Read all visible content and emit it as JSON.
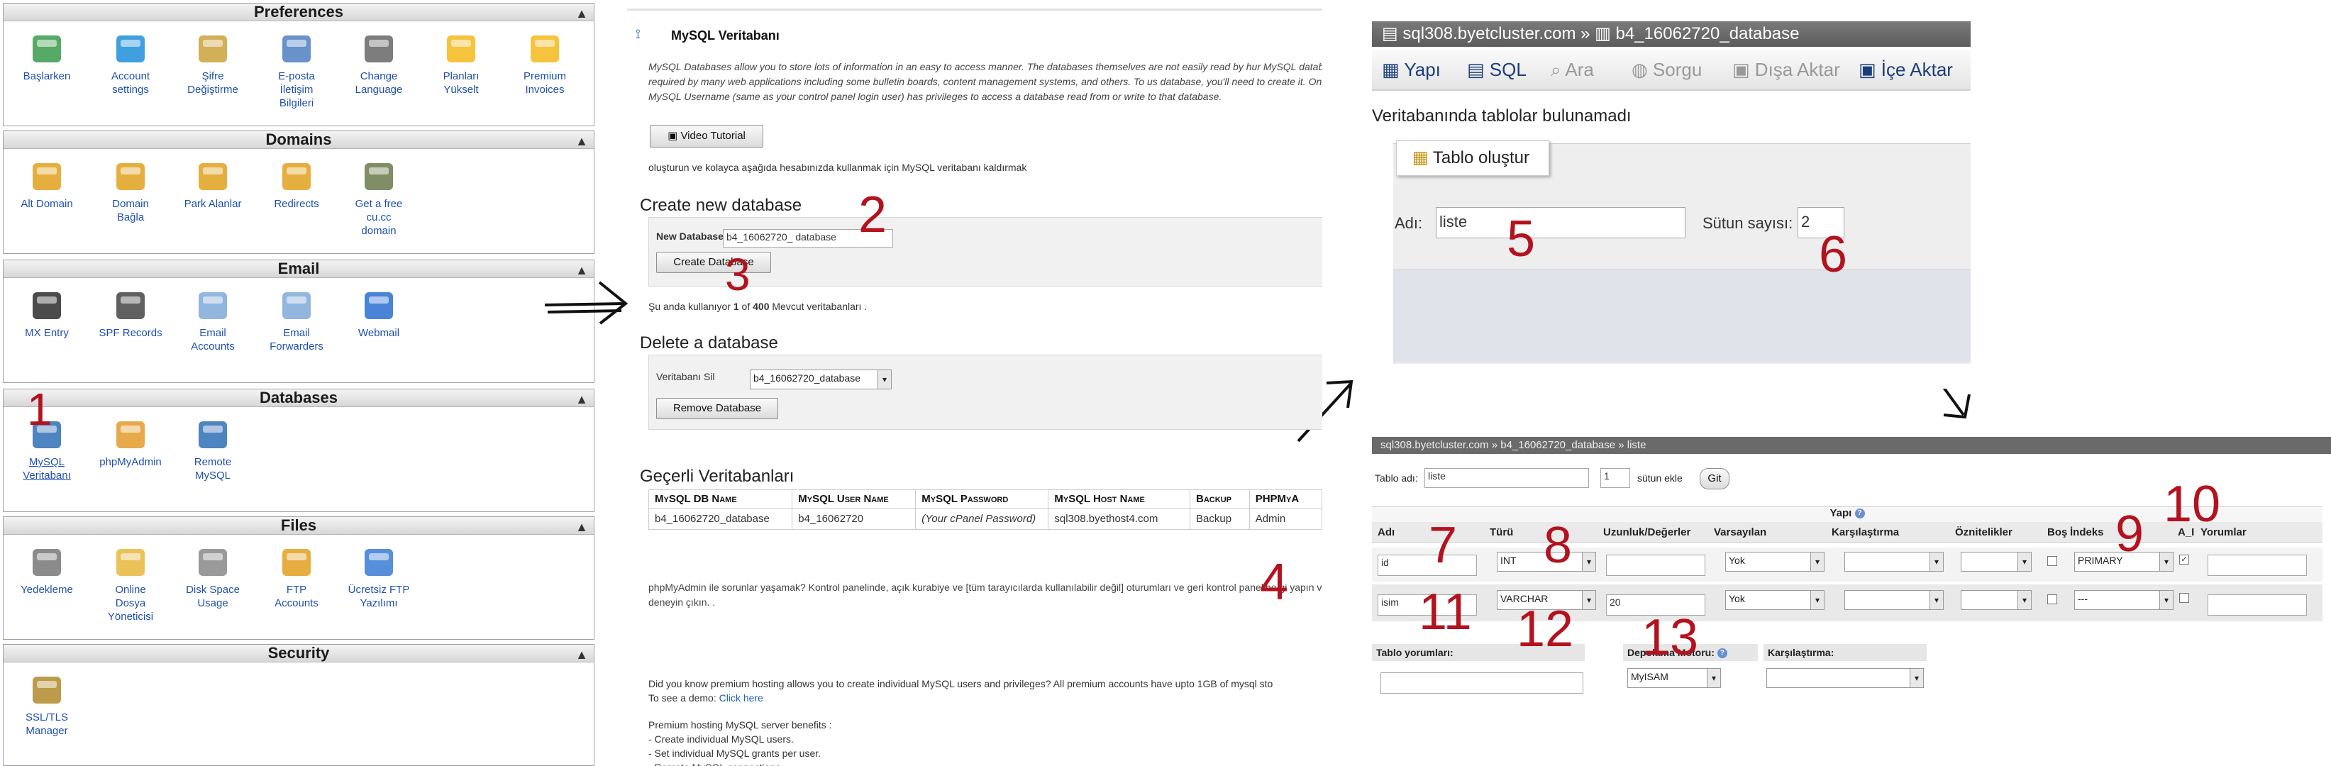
{
  "panel1": {
    "sections": [
      {
        "title": "Preferences",
        "items": [
          {
            "label": "Başlarken",
            "icon": "getting-started-icon"
          },
          {
            "label": "Account\nsettings",
            "icon": "gear-icon"
          },
          {
            "label": "Şifre\nDeğiştirme",
            "icon": "lock-icon"
          },
          {
            "label": "E-posta\nİletişim\nBilgileri",
            "icon": "address-book-icon"
          },
          {
            "label": "Change\nLanguage",
            "icon": "language-icon"
          },
          {
            "label": "Planları\nYükselt",
            "icon": "star-icon"
          },
          {
            "label": "Premium\nInvoices",
            "icon": "star-icon"
          }
        ]
      },
      {
        "title": "Domains",
        "items": [
          {
            "label": "Alt Domain",
            "icon": "www-icon"
          },
          {
            "label": "Domain\nBağla",
            "icon": "www-add-icon"
          },
          {
            "label": "Park Alanlar",
            "icon": "www-icon"
          },
          {
            "label": "Redirects",
            "icon": "www-redirect-icon"
          },
          {
            "label": "Get a free\ncu.cc\ndomain",
            "icon": "tools-icon"
          }
        ]
      },
      {
        "title": "Email",
        "items": [
          {
            "label": "MX Entry",
            "icon": "server-icon"
          },
          {
            "label": "SPF Records",
            "icon": "spf-icon"
          },
          {
            "label": "Email\nAccounts",
            "icon": "envelope-icon"
          },
          {
            "label": "Email\nForwarders",
            "icon": "envelope-forward-icon"
          },
          {
            "label": "Webmail",
            "icon": "globe-icon"
          }
        ]
      },
      {
        "title": "Databases",
        "items": [
          {
            "label": "MySQL\nVeritabanı",
            "icon": "mysql-icon"
          },
          {
            "label": "phpMyAdmin",
            "icon": "phpmyadmin-icon"
          },
          {
            "label": "Remote\nMySQL",
            "icon": "remote-mysql-icon"
          }
        ]
      },
      {
        "title": "Files",
        "items": [
          {
            "label": "Yedekleme",
            "icon": "backup-drive-icon"
          },
          {
            "label": "Online\nDosya\nYöneticisi",
            "icon": "folder-icon"
          },
          {
            "label": "Disk Space\nUsage",
            "icon": "disk-icon"
          },
          {
            "label": "FTP\nAccounts",
            "icon": "ftp-icon"
          },
          {
            "label": "Ücretsiz FTP\nYazılımı",
            "icon": "ftp-software-icon"
          }
        ]
      },
      {
        "title": "Security",
        "items": [
          {
            "label": "SSL/TLS\nManager",
            "icon": "ssl-lock-icon"
          }
        ]
      }
    ]
  },
  "panel2": {
    "title": "MySQL Veritabanı",
    "intro": "MySQL Databases allow you to store lots of information in an easy to access manner. The databases themselves are not easily read by hur MySQL databases are required by many web applications including some bulletin boards, content management systems, and others. To us database, you'll need to create it. Only your MySQL Username (same as your control panel login user) has privileges to access a database read from or write to that database.",
    "video_btn": "Video Tutorial",
    "intro2": "oluşturun ve kolayca aşağıda hesabınızda kullanmak için MySQL veritabanı kaldırmak",
    "create_heading": "Create new database",
    "new_db_label": "New Database:",
    "new_db_prefix": "b4_16062720_",
    "new_db_value": "database",
    "create_btn": "Create Database",
    "usage_text_pre": "Şu anda kullanıyor ",
    "usage_used": "1",
    "usage_of": " of ",
    "usage_total": "400",
    "usage_text_post": " Mevcut veritabanları .",
    "delete_heading": "Delete a database",
    "delete_label": "Veritabanı Sil",
    "delete_select": "b4_16062720_database",
    "remove_btn": "Remove Database",
    "current_heading": "Geçerli Veritabanları",
    "table": {
      "headers": [
        "MySQL DB Name",
        "MySQL User Name",
        "MySQL Password",
        "MySQL Host Name",
        "Backup",
        "PHPMyA"
      ],
      "row": [
        "b4_16062720_database",
        "b4_16062720",
        "(Your cPanel Password)",
        "sql308.byethost4.com",
        "Backup",
        "Admin"
      ]
    },
    "note": "phpMyAdmin ile sorunlar yaşamak? Kontrol panelinde, açık kurabiye ve [tüm tarayıcılarda kullanılabilir değil] oturumları ve geri kontrol paneline gi yapın ve tekrar deneyin çıkın. .",
    "premium1": "Did you know premium hosting allows you to create individual MySQL users and privileges? All premium accounts have upto 1GB of mysql sto",
    "premium2": "To see a demo: ",
    "premium2_link": "Click here",
    "premium3": "Premium hosting MySQL server benefits :",
    "premium4": "- Create individual MySQL users.",
    "premium5": "- Set individual MySQL grants per user.",
    "premium6": "- Remote MySQL connections"
  },
  "panel3": {
    "breadcrumb": "sql308.byetcluster.com » ",
    "breadcrumb_db": "b4_16062720_database",
    "tabs": [
      "Yapı",
      "SQL",
      "Ara",
      "Sorgu",
      "Dışa Aktar",
      "İçe Aktar"
    ],
    "no_tables": "Veritabanında tablolar bulunamadı",
    "create_table_btn": "Tablo oluştur",
    "name_label": "Adı:",
    "name_value": "liste",
    "cols_label": "Sütun sayısı:",
    "cols_value": "2"
  },
  "panel4": {
    "breadcrumb": "sql308.byetcluster.com » b4_16062720_database » liste",
    "table_name_label": "Tablo adı:",
    "table_name_value": "liste",
    "add_cols_value": "1",
    "add_cols_label": "sütun ekle",
    "go_btn": "Git",
    "structure_label": "Yapı",
    "headers": [
      "Adı",
      "Türü",
      "Uzunluk/Değerler",
      "Varsayılan",
      "Karşılaştırma",
      "Öznitelikler",
      "Boş",
      "İndeks",
      "A_I",
      "Yorumlar"
    ],
    "row1": {
      "name": "id",
      "type": "INT",
      "length": "",
      "default": "Yok",
      "index": "PRIMARY",
      "ai_checked": true
    },
    "row2": {
      "name": "isim",
      "type": "VARCHAR",
      "length": "20",
      "default": "Yok",
      "index": "---",
      "ai_checked": false
    },
    "table_comments_label": "Tablo yorumları:",
    "engine_label": "Depolama Motoru:",
    "engine_value": "MyISAM",
    "collation_label": "Karşılaştırma:"
  },
  "annotations": [
    "1",
    "2",
    "3",
    "4",
    "5",
    "6",
    "7",
    "8",
    "9",
    "10",
    "11",
    "12",
    "13"
  ],
  "colors": {
    "annotation": "#b3121f",
    "link": "#1a5fb4",
    "pma_bar": "#666666"
  }
}
